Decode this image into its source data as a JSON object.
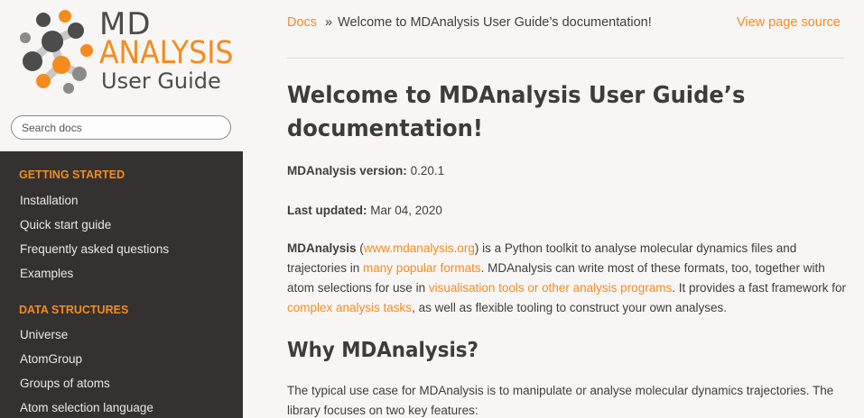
{
  "sidebar": {
    "logo": {
      "line1": "MD",
      "line2": "ANALYSIS",
      "line3": "User Guide"
    },
    "search": {
      "placeholder": "Search docs"
    },
    "sections": [
      {
        "caption": "GETTING STARTED",
        "items": [
          "Installation",
          "Quick start guide",
          "Frequently asked questions",
          "Examples"
        ]
      },
      {
        "caption": "DATA STRUCTURES",
        "items": [
          "Universe",
          "AtomGroup",
          "Groups of atoms",
          "Atom selection language"
        ]
      }
    ]
  },
  "breadcrumb": {
    "docs": "Docs",
    "separator": "»",
    "current": "Welcome to MDAnalysis User Guide’s documentation!",
    "view_source": "View page source"
  },
  "content": {
    "title": "Welcome to MDAnalysis User Guide’s documentation!",
    "version_label": "MDAnalysis version:",
    "version_value": "0.20.1",
    "updated_label": "Last updated:",
    "updated_value": "Mar 04, 2020",
    "intro": {
      "name": "MDAnalysis",
      "t1": " (",
      "link1": "www.mdanalysis.org",
      "t2": ") is a Python toolkit to analyse molecular dynamics files and trajectories in ",
      "link2": "many popular formats",
      "t3": ". MDAnalysis can write most of these formats, too, together with atom selections for use in ",
      "link3": "visualisation tools or other analysis programs",
      "t4": ". It provides a fast framework for ",
      "link4": "complex analysis tasks",
      "t5": ", as well as flexible tooling to construct your own analyses."
    },
    "why_heading": "Why MDAnalysis?",
    "why_text": "The typical use case for MDAnalysis is to manipulate or analyse molecular dynamics trajectories. The library focuses on two key features:"
  },
  "colors": {
    "accent": "#f58b1f",
    "sidebar_bg": "#343131",
    "page_bg": "#f7f6f4"
  }
}
